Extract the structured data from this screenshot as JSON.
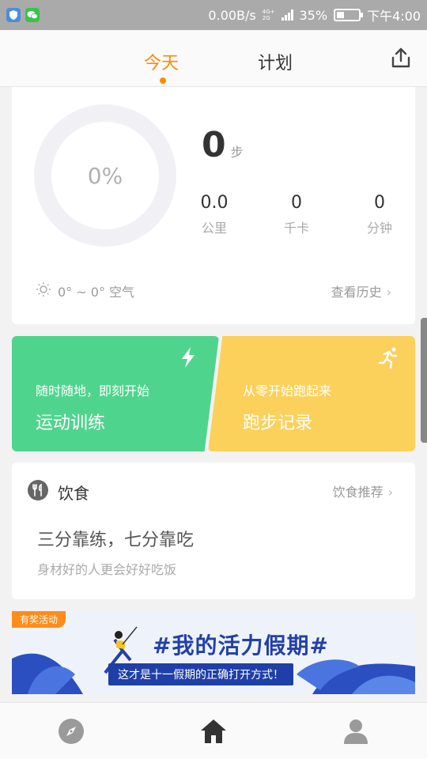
{
  "status_bar": {
    "net_speed": "0.00B/s",
    "net_type_top": "4G+",
    "net_type_bottom": "2G",
    "battery": "35%",
    "battery_level": 0.35,
    "time": "下午4:00"
  },
  "header": {
    "tabs": [
      {
        "label": "今天",
        "active": true
      },
      {
        "label": "计划",
        "active": false
      }
    ]
  },
  "summary": {
    "progress_text": "0%",
    "progress": 0,
    "steps": "0",
    "steps_unit": "步",
    "stats": [
      {
        "value": "0.0",
        "label": "公里"
      },
      {
        "value": "0",
        "label": "千卡"
      },
      {
        "value": "0",
        "label": "分钟"
      }
    ],
    "weather_text": "0° ~ 0° 空气",
    "history_link": "查看历史"
  },
  "cards": {
    "training": {
      "subtitle": "随时随地，即刻开始",
      "title": "运动训练",
      "color": "#4fd48e"
    },
    "running": {
      "subtitle": "从零开始跑起来",
      "title": "跑步记录",
      "color": "#fbd15b"
    }
  },
  "diet": {
    "title": "饮食",
    "recommend": "饮食推荐",
    "headline": "三分靠练，七分靠吃",
    "text": "身材好的人更会好好吃饭"
  },
  "banner": {
    "tag": "有奖活动",
    "headline": "#我的活力假期#",
    "subline": "这才是十一假期的正确打开方式！"
  },
  "colors": {
    "accent": "#ff8a00"
  },
  "icons": [
    "shield-icon",
    "wechat-icon",
    "share-icon",
    "sun-icon",
    "lightning-icon",
    "runner-icon",
    "fork-knife-icon",
    "compass-icon",
    "home-icon",
    "person-icon"
  ]
}
